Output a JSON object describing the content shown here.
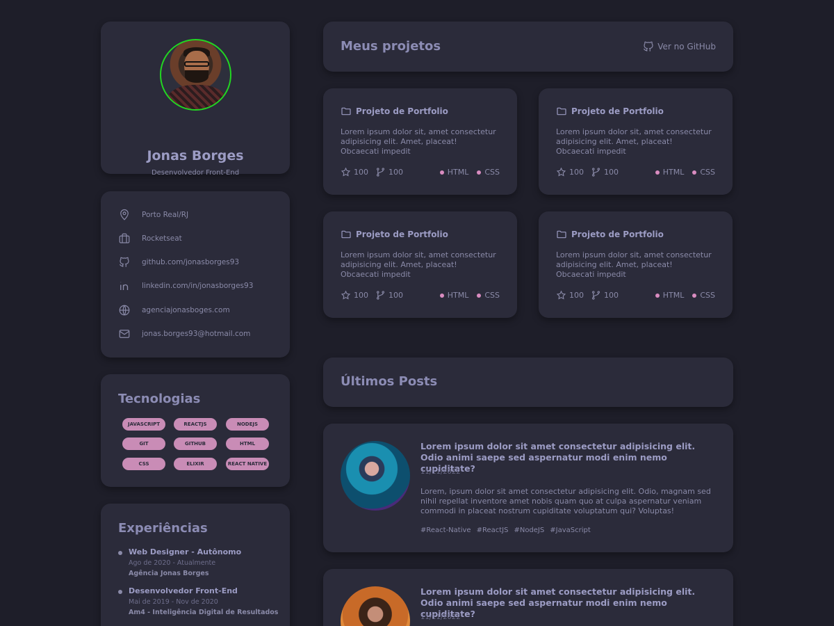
{
  "profile": {
    "name": "Jonas Borges",
    "role": "Desenvolvedor Front-End"
  },
  "contacts": [
    {
      "icon": "location-pin-icon",
      "text": "Porto Real/RJ"
    },
    {
      "icon": "briefcase-icon",
      "text": "Rocketseat"
    },
    {
      "icon": "github-icon",
      "text": "github.com/jonasborges93"
    },
    {
      "icon": "linkedin-icon",
      "text": "linkedin.com/in/jonasborges93"
    },
    {
      "icon": "globe-icon",
      "text": "agenciajonasboges.com"
    },
    {
      "icon": "mail-icon",
      "text": "jonas.borges93@hotmail.com"
    }
  ],
  "technologies": {
    "title": "Tecnologias",
    "tags": [
      "JAVASCRIPT",
      "REACTJS",
      "NODEJS",
      "GIT",
      "GITHUB",
      "HTML",
      "CSS",
      "ELIXIR",
      "REACT NATIVE"
    ]
  },
  "experiences": {
    "title": "Experiências",
    "items": [
      {
        "title": "Web Designer - Autônomo",
        "period": "Ago de 2020 - Atualmente",
        "company": "Agência Jonas Borges"
      },
      {
        "title": "Desenvolvedor Front-End",
        "period": "Mai de 2019 - Nov de 2020",
        "company": "Am4 - Inteligência Digital de Resultados"
      }
    ]
  },
  "projects": {
    "title": "Meus projetos",
    "github_link": "Ver no GitHub",
    "items": [
      {
        "title": "Projeto de Portfolio",
        "description": "Lorem ipsum dolor sit, amet consectetur adipisicing elit. Amet, placeat! Obcaecati impedit",
        "stars": "100",
        "forks": "100",
        "langs": [
          "HTML",
          "CSS"
        ]
      },
      {
        "title": "Projeto de Portfolio",
        "description": "Lorem ipsum dolor sit, amet consectetur adipisicing elit. Amet, placeat! Obcaecati impedit",
        "stars": "100",
        "forks": "100",
        "langs": [
          "HTML",
          "CSS"
        ]
      },
      {
        "title": "Projeto de Portfolio",
        "description": "Lorem ipsum dolor sit, amet consectetur adipisicing elit. Amet, placeat! Obcaecati impedit",
        "stars": "100",
        "forks": "100",
        "langs": [
          "HTML",
          "CSS"
        ]
      },
      {
        "title": "Projeto de Portfolio",
        "description": "Lorem ipsum dolor sit, amet consectetur adipisicing elit. Amet, placeat! Obcaecati impedit",
        "stars": "100",
        "forks": "100",
        "langs": [
          "HTML",
          "CSS"
        ]
      }
    ]
  },
  "posts": {
    "title": "Últimos Posts",
    "items": [
      {
        "title": "Lorem ipsum dolor sit amet consectetur adipisicing elit. Odio animi saepe sed aspernatur modi enim nemo cupiditate?",
        "date": "11/11/2022",
        "body": "Lorem, ipsum dolor sit amet consectetur adipisicing elit. Odio, magnam sed nihil repellat inventore amet nobis quam quo at culpa aspernatur veniam commodi in placeat nostrum cupiditate voluptatum qui? Voluptas!",
        "tags": [
          "#React-Native",
          "#ReactJS",
          "#NodeJS",
          "#JavaScript"
        ]
      },
      {
        "title": "Lorem ipsum dolor sit amet consectetur adipisicing elit. Odio animi saepe sed aspernatur modi enim nemo cupiditate?",
        "date": "11/11/2022"
      }
    ]
  },
  "colors": {
    "background": "#1e1e29",
    "card": "#2b2b3a",
    "tag": "#c98cb6",
    "lang_dot": "#d98cc0",
    "avatar_ring": "#22d622"
  }
}
